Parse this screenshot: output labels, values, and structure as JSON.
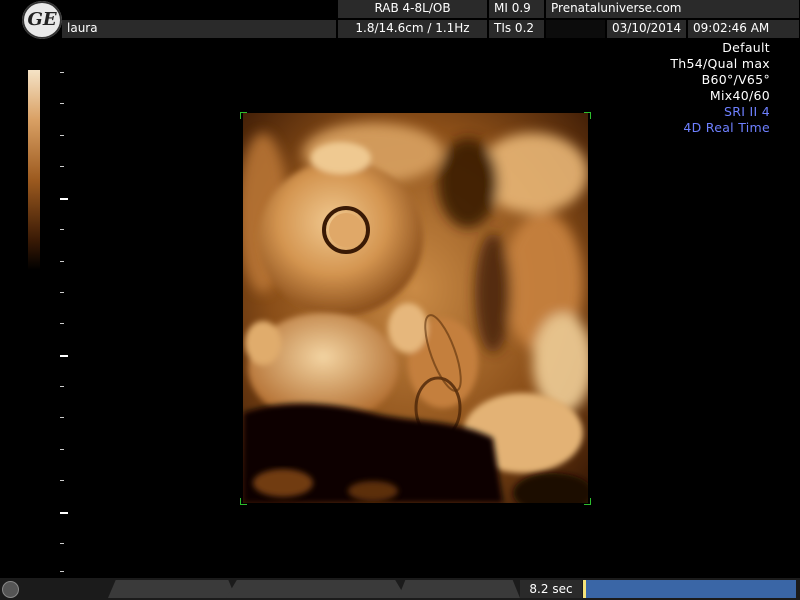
{
  "header": {
    "patient": "laura",
    "probe": "RAB 4-8L/OB",
    "mi": "MI 0.9",
    "site": "Prenataluniverse.com",
    "depth_freq": "1.8/14.6cm / 1.1Hz",
    "tis": "TIs 0.2",
    "date": "03/10/2014",
    "time": "09:02:46 AM"
  },
  "settings": {
    "preset": "Default",
    "threshold_quality": "Th54/Qual max",
    "angles": "B60°/V65°",
    "mix": "Mix40/60",
    "sri": "SRI II 4",
    "mode": "4D Real Time"
  },
  "footer": {
    "elapsed": "8.2 sec"
  },
  "colors": {
    "accent_blue": "#6e80ff",
    "corner_marker": "#2dbe2d",
    "progress": "#3a66a6"
  },
  "icons": {
    "logo": "ge-logo-icon"
  }
}
